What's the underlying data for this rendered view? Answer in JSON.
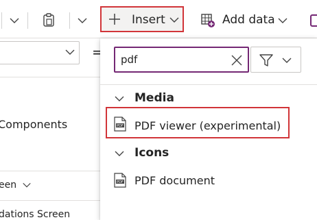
{
  "ribbon": {
    "insert_label": "Insert",
    "add_data_label": "Add data"
  },
  "left_panel": {
    "equals": "=",
    "components_label": "Components",
    "screen_label": "een",
    "screen2_label": "dations Screen"
  },
  "flyout": {
    "search": {
      "value": "pdf"
    },
    "categories": [
      {
        "label": "Media",
        "items": [
          {
            "label": "PDF viewer (experimental)",
            "icon": "pdf-icon"
          }
        ]
      },
      {
        "label": "Icons",
        "items": [
          {
            "label": "PDF document",
            "icon": "pdf-icon"
          }
        ]
      }
    ]
  },
  "colors": {
    "accent": "#742774",
    "highlight_border": "#d13438"
  }
}
